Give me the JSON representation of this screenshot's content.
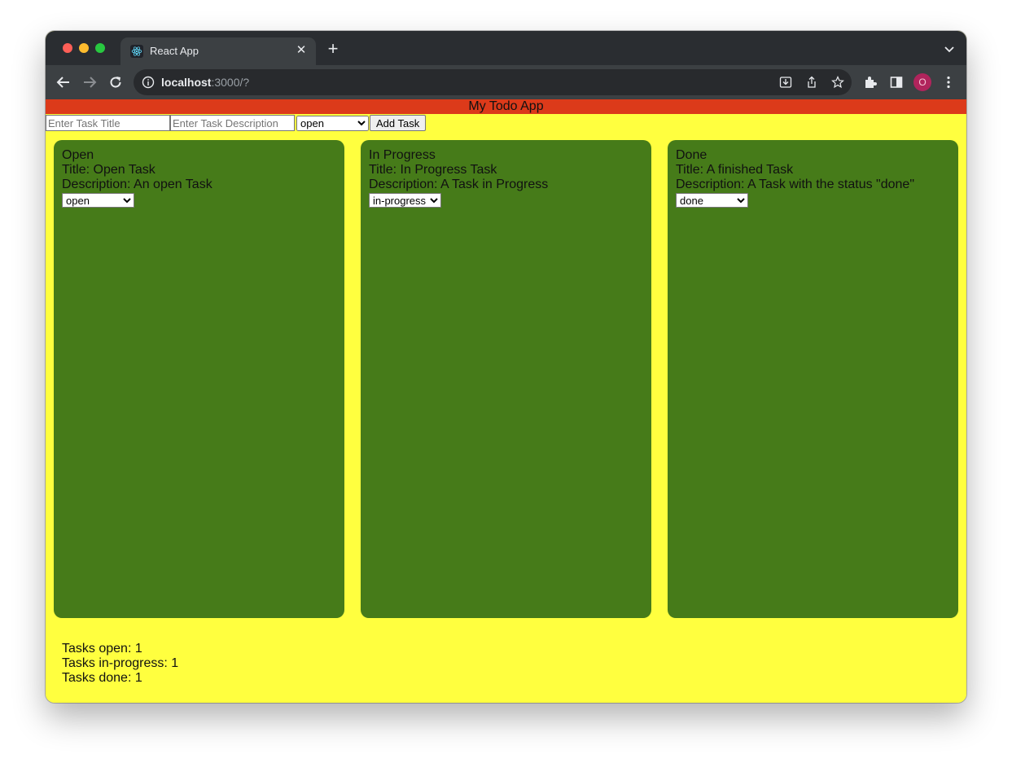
{
  "browser": {
    "tab_title": "React App",
    "url_host": "localhost",
    "url_rest": ":3000/?",
    "profile_initial": "O"
  },
  "app": {
    "title": "My Todo App",
    "form": {
      "title_placeholder": "Enter Task Title",
      "description_placeholder": "Enter Task Description",
      "status_selected": "open",
      "add_button": "Add Task"
    },
    "columns": [
      {
        "heading": "Open",
        "task": {
          "title": "Title: Open Task",
          "description": "Description: An open Task",
          "status": "open"
        }
      },
      {
        "heading": "In Progress",
        "task": {
          "title": "Title: In Progress Task",
          "description": "Description: A Task in Progress",
          "status": "in-progress"
        }
      },
      {
        "heading": "Done",
        "task": {
          "title": "Title: A finished Task",
          "description": "Description: A Task with the status \"done\"",
          "status": "done"
        }
      }
    ],
    "summary": {
      "open": "Tasks open: 1",
      "in_progress": "Tasks in-progress: 1",
      "done": "Tasks done: 1"
    }
  },
  "colors": {
    "header": "#dc3a1a",
    "page_background": "#ffff3f",
    "column_background": "#467b19"
  }
}
